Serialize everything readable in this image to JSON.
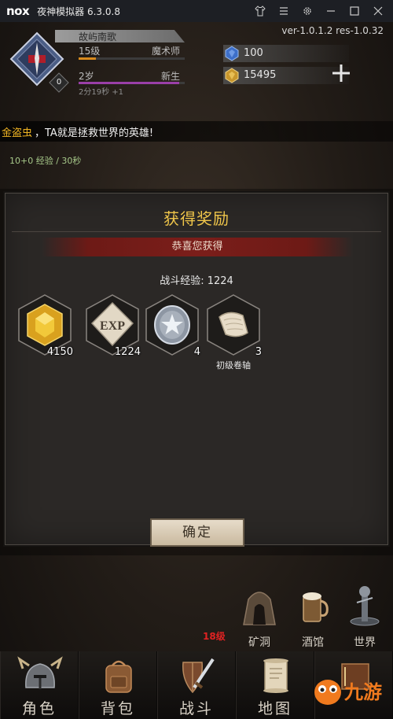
{
  "emulator": {
    "logo": "nox",
    "title": "夜神模拟器 6.3.0.8",
    "controls": [
      "shirt-icon",
      "menu-icon",
      "gear-icon",
      "minimize-icon",
      "maximize-icon",
      "close-icon"
    ]
  },
  "game": {
    "version": "ver-1.0.1.2  res-1.0.32",
    "player": {
      "name": "故屿南歌",
      "level": "15级",
      "class": "魔术师",
      "age": "2岁",
      "stage": "新生",
      "timer": "2分19秒 +1",
      "badge": "0",
      "level_progress": 0.16,
      "age_progress": 0.95
    },
    "resources": [
      {
        "icon": "blue-gem-icon",
        "value": "100"
      },
      {
        "icon": "gold-gem-icon",
        "value": "15495"
      }
    ],
    "broadcast": {
      "highlight": "金盗虫",
      "message": "，TA就是拯救世界的英雄!"
    },
    "background_text": {
      "exp_line": "10+0 经验 / 30秒"
    },
    "reward_modal": {
      "title": "获得奖励",
      "ribbon": "恭喜您获得",
      "exp_text": "战斗经验: 1224",
      "items": [
        {
          "icon": "gold-gem-icon",
          "count": "4150",
          "label": ""
        },
        {
          "icon": "exp-icon",
          "count": "1224",
          "label": ""
        },
        {
          "icon": "silver-coin-star-icon",
          "count": "4",
          "label": ""
        },
        {
          "icon": "scroll-icon",
          "count": "3",
          "label": "初级卷轴"
        }
      ],
      "confirm_label": "确定"
    },
    "town": {
      "level_tag": "18级",
      "buildings": [
        {
          "icon": "mine-icon",
          "label": "矿洞"
        },
        {
          "icon": "tavern-icon",
          "label": "酒馆"
        },
        {
          "icon": "world-icon",
          "label": "世界"
        }
      ]
    },
    "nav": [
      {
        "icon": "helmet-icon",
        "label": "角色"
      },
      {
        "icon": "backpack-icon",
        "label": "背包"
      },
      {
        "icon": "sword-shield-icon",
        "label": "战斗"
      },
      {
        "icon": "map-scroll-icon",
        "label": "地图"
      },
      {
        "icon": "book-icon",
        "label": ""
      }
    ],
    "watermark": "九游"
  }
}
